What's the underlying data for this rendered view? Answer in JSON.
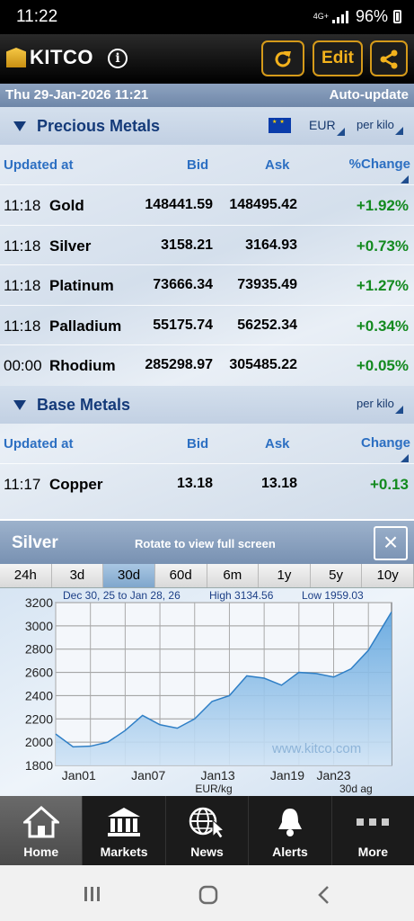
{
  "status": {
    "time": "11:22",
    "signal": "4G+",
    "battery": "96%"
  },
  "header": {
    "logo": "KITCO",
    "edit_label": "Edit"
  },
  "datebar": {
    "date": "Thu 29-Jan-2026 11:21",
    "update_mode": "Auto-update"
  },
  "precious": {
    "title": "Precious Metals",
    "currency": "EUR",
    "unit": "per kilo",
    "columns": {
      "updated": "Updated at",
      "bid": "Bid",
      "ask": "Ask",
      "change": "%Change"
    },
    "rows": [
      {
        "time": "11:18",
        "name": "Gold",
        "bid": "148441.59",
        "ask": "148495.42",
        "change": "+1.92%"
      },
      {
        "time": "11:18",
        "name": "Silver",
        "bid": "3158.21",
        "ask": "3164.93",
        "change": "+0.73%"
      },
      {
        "time": "11:18",
        "name": "Platinum",
        "bid": "73666.34",
        "ask": "73935.49",
        "change": "+1.27%"
      },
      {
        "time": "11:18",
        "name": "Palladium",
        "bid": "55175.74",
        "ask": "56252.34",
        "change": "+0.34%"
      },
      {
        "time": "00:00",
        "name": "Rhodium",
        "bid": "285298.97",
        "ask": "305485.22",
        "change": "+0.05%"
      }
    ]
  },
  "base": {
    "title": "Base Metals",
    "unit": "per kilo",
    "columns": {
      "updated": "Updated at",
      "bid": "Bid",
      "ask": "Ask",
      "change": "Change"
    },
    "rows": [
      {
        "time": "11:17",
        "name": "Copper",
        "bid": "13.18",
        "ask": "13.18",
        "change": "+0.13"
      }
    ]
  },
  "chart_panel": {
    "metal": "Silver",
    "rotate_hint": "Rotate to view full screen",
    "ranges": [
      "24h",
      "3d",
      "30d",
      "60d",
      "6m",
      "1y",
      "5y",
      "10y"
    ],
    "active_range": "30d"
  },
  "chart_data": {
    "type": "area",
    "date_range": "Dec 30, 25 to Jan 28, 26",
    "high_label": "High 3134.56",
    "low_label": "Low 1959.03",
    "watermark": "www.kitco.com",
    "unit_label": "EUR/kg",
    "period_label": "30d ag",
    "y_ticks": [
      1800,
      2000,
      2200,
      2400,
      2600,
      2800,
      3000,
      3200
    ],
    "ylim": [
      1800,
      3200
    ],
    "xlim": [
      0,
      29
    ],
    "x_ticks": [
      {
        "label": "Jan01",
        "x": 2
      },
      {
        "label": "Jan07",
        "x": 8
      },
      {
        "label": "Jan13",
        "x": 14
      },
      {
        "label": "Jan19",
        "x": 20
      },
      {
        "label": "Jan23",
        "x": 24
      }
    ],
    "x": [
      0,
      1.5,
      3,
      4.5,
      6,
      7.5,
      9,
      10.5,
      12,
      13.5,
      15,
      16.5,
      18,
      19.5,
      21,
      22.5,
      24,
      25.5,
      27,
      29
    ],
    "values": [
      2070,
      1960,
      1965,
      2000,
      2100,
      2230,
      2150,
      2120,
      2200,
      2350,
      2400,
      2570,
      2550,
      2490,
      2600,
      2590,
      2560,
      2630,
      2790,
      3120
    ]
  },
  "nav": {
    "items": [
      {
        "label": "Home",
        "active": true
      },
      {
        "label": "Markets",
        "active": false
      },
      {
        "label": "News",
        "active": false
      },
      {
        "label": "Alerts",
        "active": false
      },
      {
        "label": "More",
        "active": false
      }
    ]
  },
  "colors": {
    "accent": "#f3b21c",
    "positive": "#138a1f",
    "header_blue": "#143a79"
  }
}
